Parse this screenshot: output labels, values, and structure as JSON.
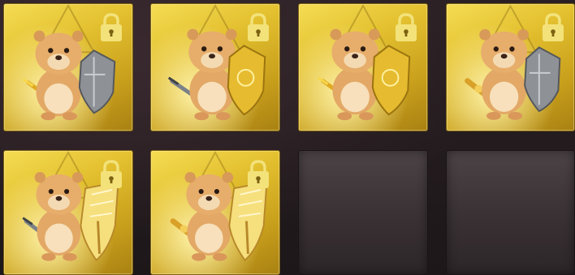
{
  "grid": {
    "slots": [
      {
        "state": "locked",
        "shield": "iron-shield-icon",
        "weapon": "gold-sword-icon"
      },
      {
        "state": "locked",
        "shield": "gold-shield-icon",
        "weapon": "iron-sword-icon"
      },
      {
        "state": "locked",
        "shield": "gold-shield-icon",
        "weapon": "gold-sword-icon"
      },
      {
        "state": "locked",
        "shield": "iron-shield-icon",
        "weapon": "ornate-sword-icon"
      },
      {
        "state": "locked",
        "shield": "winged-shield-icon",
        "weapon": "iron-sword-icon"
      },
      {
        "state": "locked",
        "shield": "winged-shield-icon",
        "weapon": "ornate-sword-icon"
      },
      {
        "state": "empty"
      },
      {
        "state": "empty"
      }
    ]
  },
  "colors": {
    "slot_gold": "#e3c02f",
    "slot_empty": "#3a3235",
    "lock": "#f3e27a",
    "background": "#241c1f"
  }
}
